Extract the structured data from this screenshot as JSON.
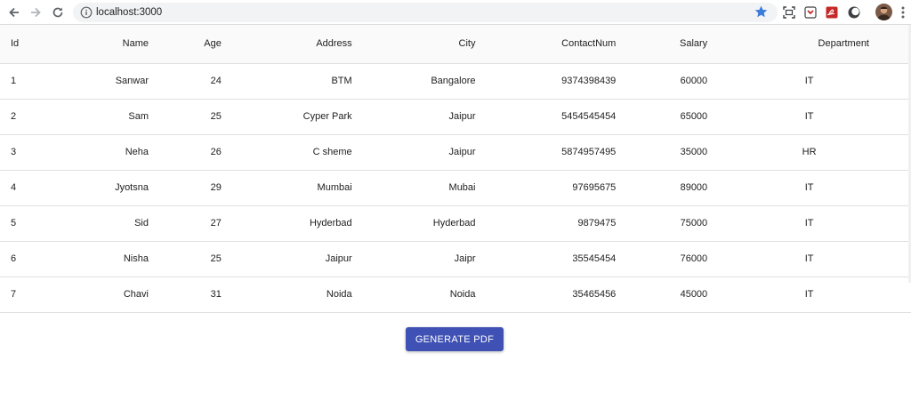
{
  "browser": {
    "url": "localhost:3000",
    "accent_star": "#3b7bdc"
  },
  "table": {
    "columns": [
      "Id",
      "Name",
      "Age",
      "Address",
      "City",
      "ContactNum",
      "Salary",
      "Department"
    ],
    "rows": [
      [
        "1",
        "Sanwar",
        "24",
        "BTM",
        "Bangalore",
        "9374398439",
        "60000",
        "IT"
      ],
      [
        "2",
        "Sam",
        "25",
        "Cyper Park",
        "Jaipur",
        "5454545454",
        "65000",
        "IT"
      ],
      [
        "3",
        "Neha",
        "26",
        "C sheme",
        "Jaipur",
        "5874957495",
        "35000",
        "HR"
      ],
      [
        "4",
        "Jyotsna",
        "29",
        "Mumbai",
        "Mubai",
        "97695675",
        "89000",
        "IT"
      ],
      [
        "5",
        "Sid",
        "27",
        "Hyderbad",
        "Hyderbad",
        "9879475",
        "75000",
        "IT"
      ],
      [
        "6",
        "Nisha",
        "25",
        "Jaipur",
        "Jaipr",
        "35545454",
        "76000",
        "IT"
      ],
      [
        "7",
        "Chavi",
        "31",
        "Noida",
        "Noida",
        "35465456",
        "45000",
        "IT"
      ]
    ]
  },
  "actions": {
    "generate_pdf_label": "GENERATE PDF",
    "button_color": "#3f51b5"
  }
}
